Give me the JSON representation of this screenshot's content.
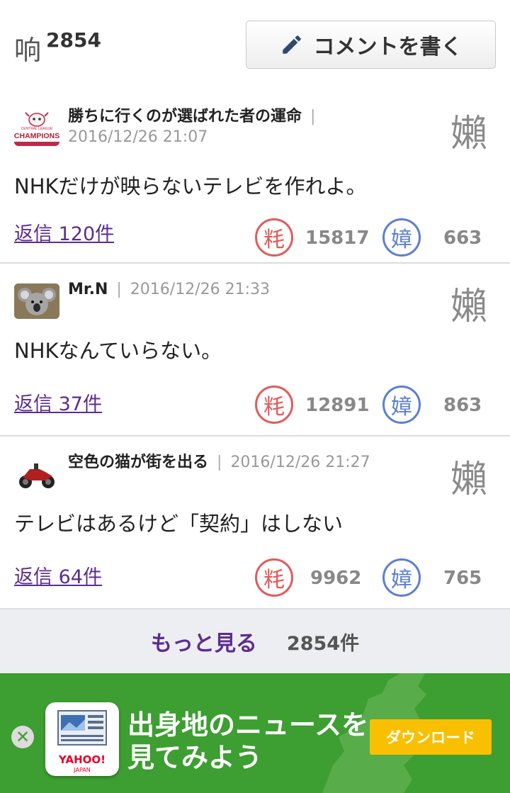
{
  "header": {
    "count_label": "响",
    "count": "2854",
    "write_button": "コメントを書く"
  },
  "comments": [
    {
      "user": "勝ちに行くのが選ばれた者の運命",
      "timestamp": "2016/12/26 21:07",
      "text": "NHKだけが映らないテレビを作れよ。",
      "reply": "返信 120件",
      "like_icon": "粍",
      "dislike_icon": "嫜",
      "flag_icon": "嬾",
      "likes": "15817",
      "dislikes": "663",
      "avatar_text": "CHAMPIONS",
      "avatar_sub": "CENTRAL LEAGUE"
    },
    {
      "user": "Mr.N",
      "timestamp": "2016/12/26 21:33",
      "text": "NHKなんていらない。",
      "reply": "返信 37件",
      "like_icon": "粍",
      "dislike_icon": "嫜",
      "flag_icon": "嬾",
      "likes": "12891",
      "dislikes": "863"
    },
    {
      "user": "空色の猫が街を出る",
      "timestamp": "2016/12/26 21:27",
      "text": "テレビはあるけど「契約」はしない",
      "reply": "返信 64件",
      "like_icon": "粍",
      "dislike_icon": "嫜",
      "flag_icon": "嬾",
      "likes": "9962",
      "dislikes": "765"
    }
  ],
  "more": {
    "label": "もっと見る",
    "count": "2854件"
  },
  "ad": {
    "close_glyph": "✕",
    "line1": "出身地のニュースを",
    "line2": "見てみよう",
    "download": "ダウンロード",
    "brand": "YAHOO!",
    "brand_sub": "JAPAN"
  },
  "colors": {
    "accent_purple": "#5b2d8f",
    "like_red": "#e25a5a",
    "dislike_blue": "#5b7fd1",
    "ad_green": "#3d9e31",
    "download_yellow": "#f8c000"
  }
}
